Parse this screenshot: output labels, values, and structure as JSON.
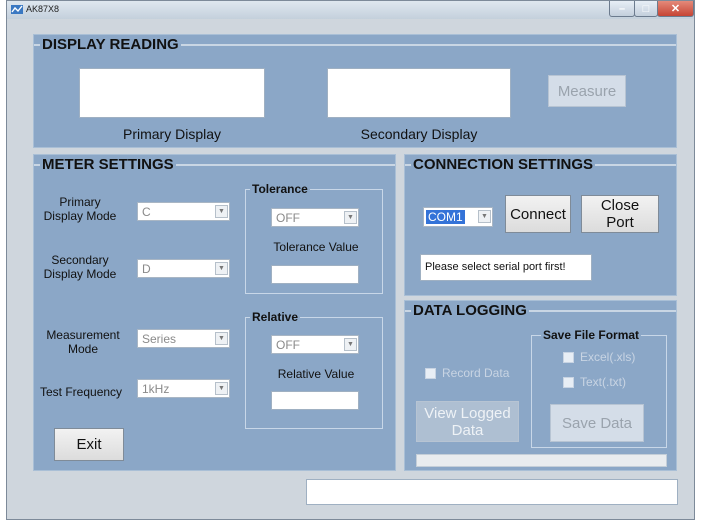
{
  "window": {
    "title": "AK87X8"
  },
  "display_reading": {
    "title": "DISPLAY READING",
    "primary_label": "Primary Display",
    "secondary_label": "Secondary Display",
    "measure_label": "Measure",
    "primary_value": "",
    "secondary_value": ""
  },
  "meter_settings": {
    "title": "METER SETTINGS",
    "primary_mode_label": "Primary\nDisplay Mode",
    "primary_mode_value": "C",
    "secondary_mode_label": "Secondary\nDisplay Mode",
    "secondary_mode_value": "D",
    "measurement_mode_label": "Measurement\nMode",
    "measurement_mode_value": "Series",
    "test_frequency_label": "Test Frequency",
    "test_frequency_value": "1kHz",
    "tolerance": {
      "title": "Tolerance",
      "value": "OFF",
      "value_label": "Tolerance Value",
      "input": ""
    },
    "relative": {
      "title": "Relative",
      "value": "OFF",
      "value_label": "Relative Value",
      "input": ""
    },
    "exit_label": "Exit"
  },
  "connection_settings": {
    "title": "CONNECTION SETTINGS",
    "port_value": "COM1",
    "connect_label": "Connect",
    "close_port_label": "Close\nPort",
    "status_text": "Please select serial port first!"
  },
  "data_logging": {
    "title": "DATA LOGGING",
    "record_data_label": "Record Data",
    "view_logged_label": "View Logged\nData",
    "save_format": {
      "title": "Save File Format",
      "excel_label": "Excel(.xls)",
      "text_label": "Text(.txt)"
    },
    "save_data_label": "Save Data"
  },
  "statusbar": {
    "text": ""
  }
}
